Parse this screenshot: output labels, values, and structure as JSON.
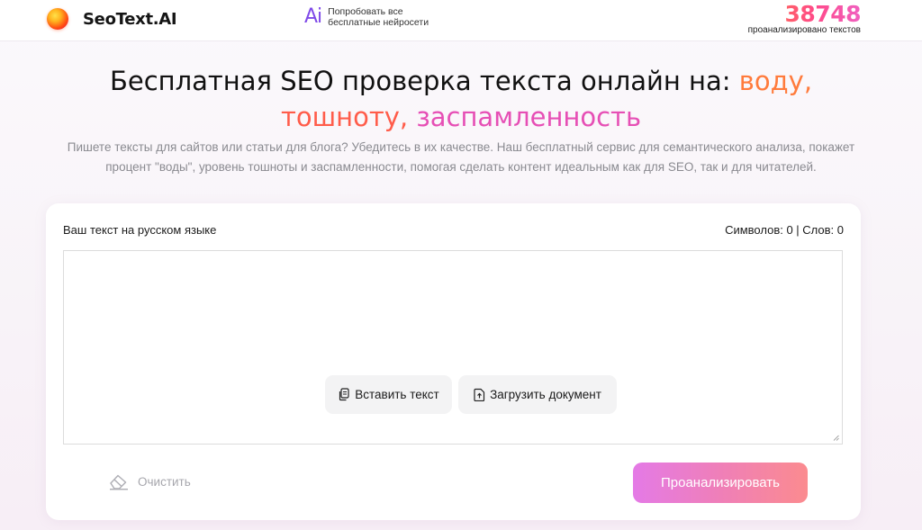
{
  "header": {
    "logo_text": "SeoText.AI",
    "ai_mark": "Ai",
    "ai_promo_line1": "Попробовать все",
    "ai_promo_line2": "бесплатные нейросети",
    "counter_value": "38748",
    "counter_label": "проанализировано текстов"
  },
  "hero": {
    "title_prefix": "Бесплатная SEO проверка текста онлайн на: ",
    "title_water": "воду,",
    "title_nausea": "тошноту,",
    "title_spam": "заспамленность",
    "subtitle": "Пишете тексты для сайтов или статьи для блога? Убедитесь в их качестве. Наш бесплатный сервис для семантического анализа, покажет процент \"воды\", уровень тошноты и заспамленности, помогая сделать контент идеальным как для SEO, так и для читателей."
  },
  "editor": {
    "label": "Ваш текст на русском языке",
    "count_text": "Символов: 0 | Слов: 0",
    "paste_label": "Вставить текст",
    "upload_label": "Загрузить документ",
    "clear_label": "Очистить",
    "analyze_label": "Проанализировать"
  },
  "icons": {
    "paste": "clipboard-icon",
    "upload": "file-upload-icon",
    "clear": "eraser-icon"
  },
  "colors": {
    "water": "#ff7b3c",
    "nausea": "#ff5c4a",
    "spam": "#e64fb5",
    "ai_accent": "#7f4ae8",
    "analyze_gradient_start": "#e47ae6",
    "analyze_gradient_end": "#fb8b8f"
  }
}
